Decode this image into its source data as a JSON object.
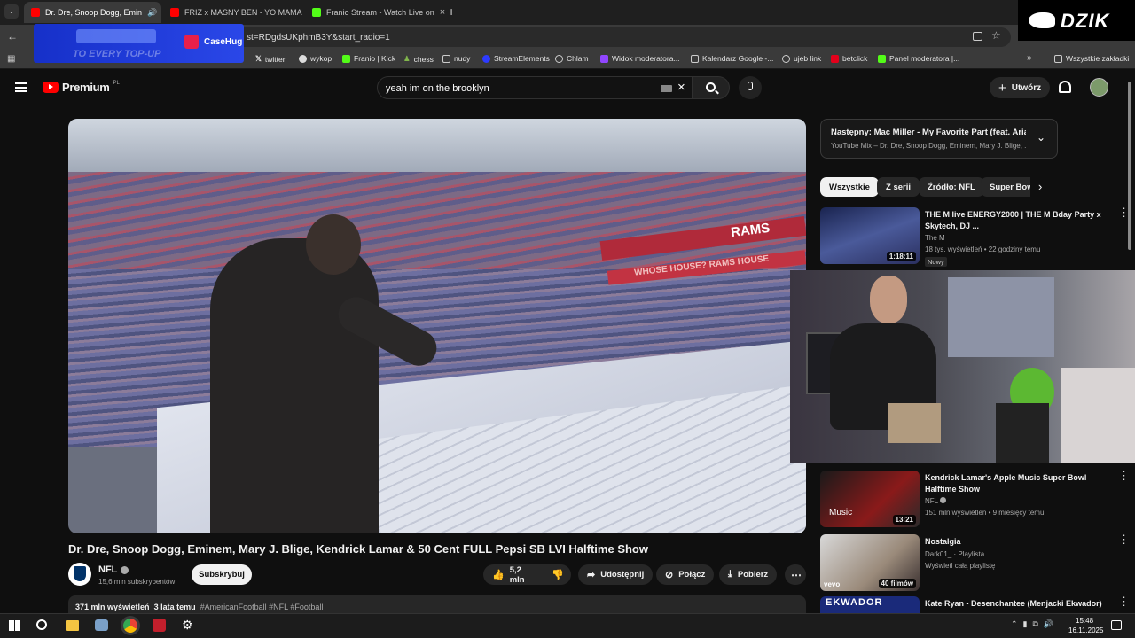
{
  "browser": {
    "tabs": [
      {
        "label": "Dr. Dre, Snoop Dogg, Emin"
      },
      {
        "label": "FRIZ x MASNY BEN - YO MAMA"
      },
      {
        "label": "Franio Stream - Watch Live on"
      }
    ],
    "url": "st=RDgdsUKphmB3Y&start_radio=1",
    "bookmarks": [
      "twitter",
      "wykop",
      "Franio | Kick",
      "chess",
      "nudy",
      "StreamElements",
      "Chlam",
      "Widok moderatora...",
      "Kalendarz Google -...",
      "ujeb link",
      "betclick",
      "Panel moderatora |..."
    ],
    "all_bookmarks": "Wszystkie zakładki"
  },
  "overlays": {
    "casehug_brand": "CaseHug",
    "casehug_tagline": "TO EVERY TOP-UP",
    "dzik": "DZIK"
  },
  "youtube": {
    "logo": "Premium",
    "logo_region": "PL",
    "search_value": "yeah im on the brooklyn",
    "create_label": "Utwórz",
    "video_title": "Dr. Dre, Snoop Dogg, Eminem, Mary J. Blige, Kendrick Lamar & 50 Cent FULL Pepsi SB LVI Halftime Show",
    "channel": "NFL",
    "subscribers": "15,6 mln subskrybentów",
    "subscribe": "Subskrybuj",
    "likes": "5,2 mln",
    "share": "Udostępnij",
    "connect": "Połącz",
    "download": "Pobierz",
    "desc_views": "371 mln wyświetleń",
    "desc_age": "3 lata temu",
    "desc_tags": "#AmericanFootball #NFL #Football",
    "stadium_sign": "RAMS",
    "stadium_sign2": "WHOSE HOUSE? RAMS HOUSE",
    "next_title": "Następny: Mac Miller - My Favorite Part (feat. Arian...",
    "next_sub": "YouTube Mix – Dr. Dre, Snoop Dogg, Eminem, Mary J. Blige, ...",
    "chips": [
      "Wszystkie",
      "Z serii",
      "Źródło: NFL",
      "Super Bow"
    ],
    "recs": [
      {
        "title": "THE M live ENERGY2000 | THE M Bday Party x Skytech, DJ ...",
        "channel": "The M",
        "meta": "18 tys. wyświetleń • 22 godziny temu",
        "duration": "1:18:11",
        "badge": "Nowy"
      },
      {
        "title": "Kendrick Lamar's Apple Music Super Bowl Halftime Show",
        "channel": "NFL",
        "meta": "151 mln wyświetleń • 9 miesięcy temu",
        "duration": "13:21",
        "thumb_text": "Music"
      },
      {
        "title": "Nostalgia",
        "channel": "Dark01_ · Playlista",
        "meta": "Wyświetl całą playlistę",
        "duration": "40 filmów",
        "thumb_text": "vevo"
      },
      {
        "title": "Kate Ryan - Desenchantee (Menjacki Ekwador)",
        "channel": "",
        "meta": "",
        "thumb_text": "EKWADOR"
      }
    ]
  },
  "taskbar": {
    "time": "15:48",
    "date": "16.11.2025"
  },
  "colors": {
    "yt_red": "#ff0000",
    "kick_green": "#53fc18",
    "casehug_blue": "#1e3ad6"
  }
}
